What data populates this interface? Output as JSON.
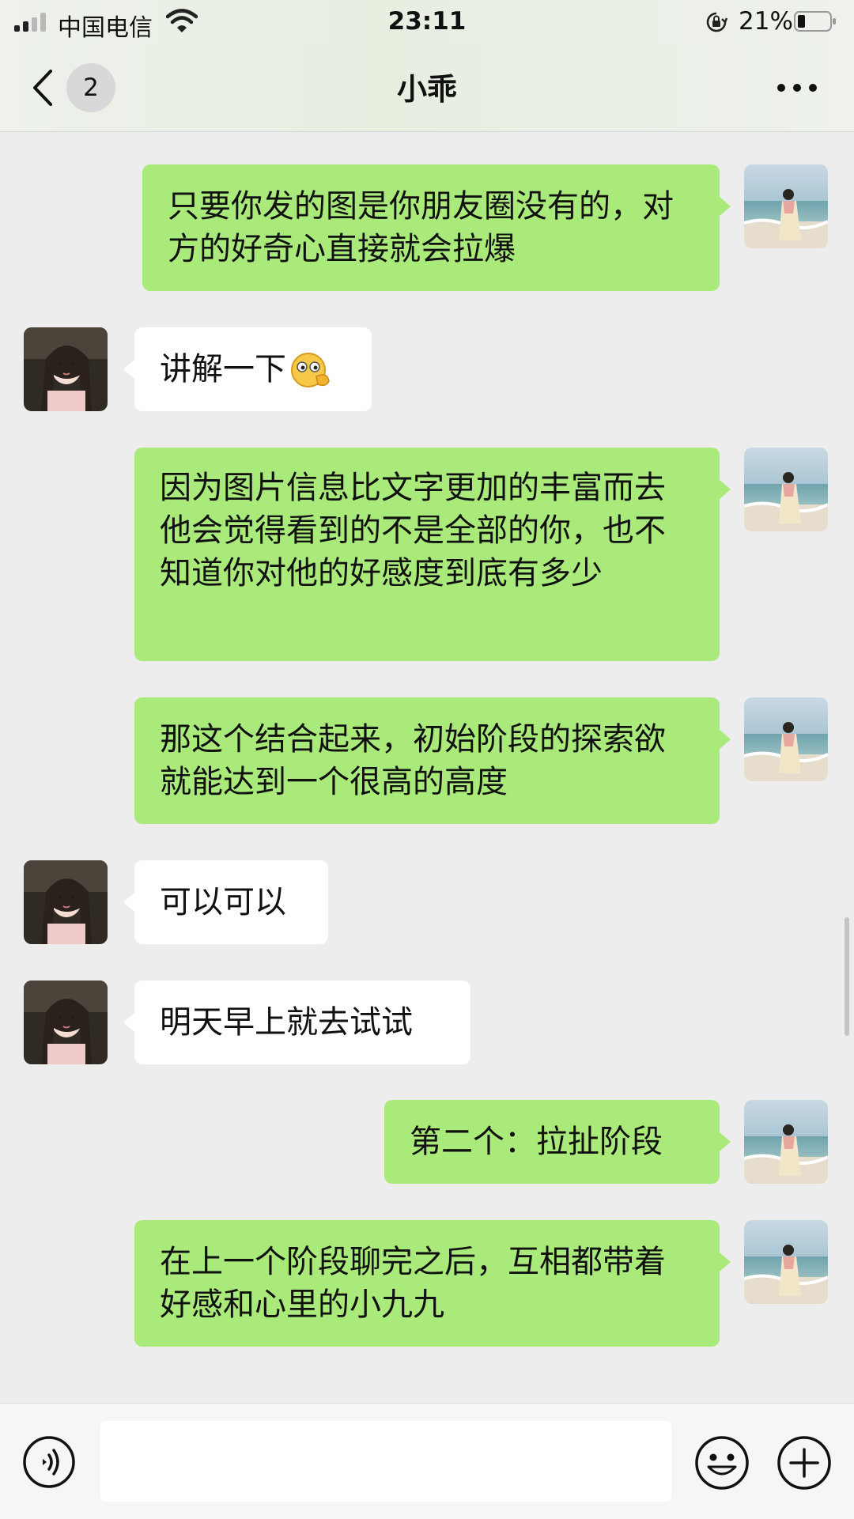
{
  "status_bar": {
    "carrier": "中国电信",
    "time": "23:11",
    "battery": "21%"
  },
  "header": {
    "unread_count": "2",
    "title": "小乖"
  },
  "messages": [
    {
      "sender": "me",
      "text": "只要你发的图是你朋友圈没有的，对方的好奇心直接就会拉爆"
    },
    {
      "sender": "them",
      "text": "讲解一下",
      "emoji": "thinking-emoji"
    },
    {
      "sender": "me",
      "text": "因为图片信息比文字更加的丰富而去他会觉得看到的不是全部的你，也不知道你对他的好感度到底有多少"
    },
    {
      "sender": "me",
      "text": "那这个结合起来，初始阶段的探索欲就能达到一个很高的高度"
    },
    {
      "sender": "them",
      "text": "可以可以"
    },
    {
      "sender": "them",
      "text": "明天早上就去试试"
    },
    {
      "sender": "me",
      "text": "第二个：拉扯阶段"
    },
    {
      "sender": "me",
      "text": "在上一个阶段聊完之后，互相都带着好感和心里的小九九"
    }
  ],
  "icons": {
    "back": "chevron-left-icon",
    "more": "more-dots-icon",
    "voice": "voice-icon",
    "emoji": "smiley-icon",
    "plus": "plus-icon"
  },
  "colors": {
    "my_bubble": "#a9ea7a",
    "their_bubble": "#ffffff",
    "background": "#ededed"
  }
}
